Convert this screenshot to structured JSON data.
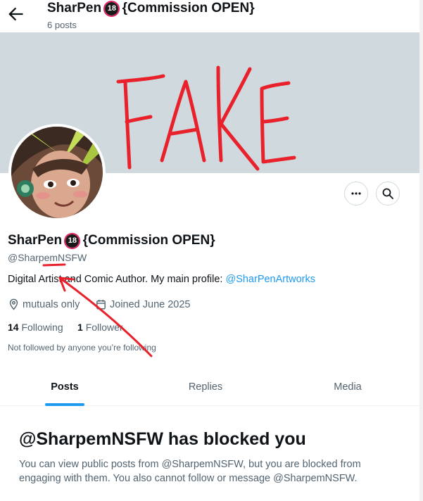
{
  "header": {
    "title_prefix": "SharPen",
    "title_badge": "18",
    "title_suffix": "{Commission OPEN}",
    "post_count": "6 posts"
  },
  "banner": {
    "overlay_text": "FAKE",
    "overlay_color": "#e8212b"
  },
  "profile": {
    "name_prefix": "SharPen",
    "name_badge": "18",
    "name_suffix": "{Commission OPEN}",
    "handle": "@SharpemNSFW",
    "bio_text": "Digital Artist and Comic Author. My main profile: ",
    "bio_link": "@SharPenArtworks",
    "location": "mutuals only",
    "joined": "Joined June 2025",
    "following_count": "14",
    "following_label": "Following",
    "followers_count": "1",
    "followers_label": "Follower",
    "not_followed": "Not followed by anyone you’re following"
  },
  "actions": {
    "more_icon": "more-icon",
    "search_icon": "search-icon"
  },
  "tabs": [
    {
      "label": "Posts",
      "active": true
    },
    {
      "label": "Replies",
      "active": false
    },
    {
      "label": "Media",
      "active": false
    }
  ],
  "blocked": {
    "title": "@SharpemNSFW has blocked you",
    "body": "You can view public posts from @SharpemNSFW, but you are blocked from engaging with them. You also cannot follow or message @SharpemNSFW."
  },
  "colors": {
    "accent": "#1d9bf0",
    "banner": "#cfd9de",
    "annotation_red": "#e8212b"
  }
}
